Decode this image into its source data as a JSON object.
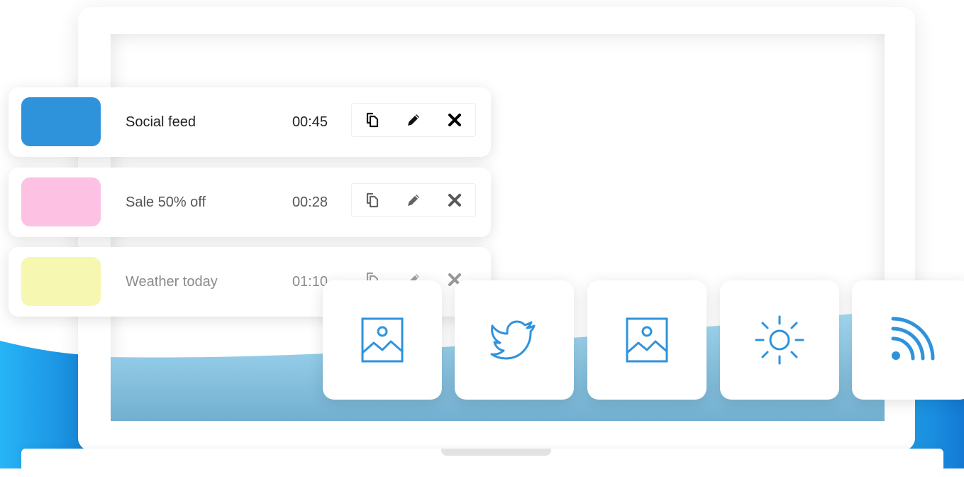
{
  "colors": {
    "accent": "#2f93dc",
    "wave_light": "#a6dcf5",
    "wave_dark": "#6aa8c8",
    "bg_blue": "#1fa0e8"
  },
  "playlist": {
    "items": [
      {
        "title": "Social feed",
        "duration": "00:45",
        "color": "#2f93dc"
      },
      {
        "title": "Sale 50% off",
        "duration": "00:28",
        "color": "#fdc2e3"
      },
      {
        "title": "Weather today",
        "duration": "01:10",
        "color": "#f6f7b0"
      }
    ],
    "actions": [
      "copy-icon",
      "pencil-icon",
      "close-icon"
    ]
  },
  "widgets": [
    {
      "icon": "image-icon"
    },
    {
      "icon": "twitter-bird-icon"
    },
    {
      "icon": "image-icon"
    },
    {
      "icon": "sun-icon"
    },
    {
      "icon": "rss-feed-icon"
    }
  ]
}
